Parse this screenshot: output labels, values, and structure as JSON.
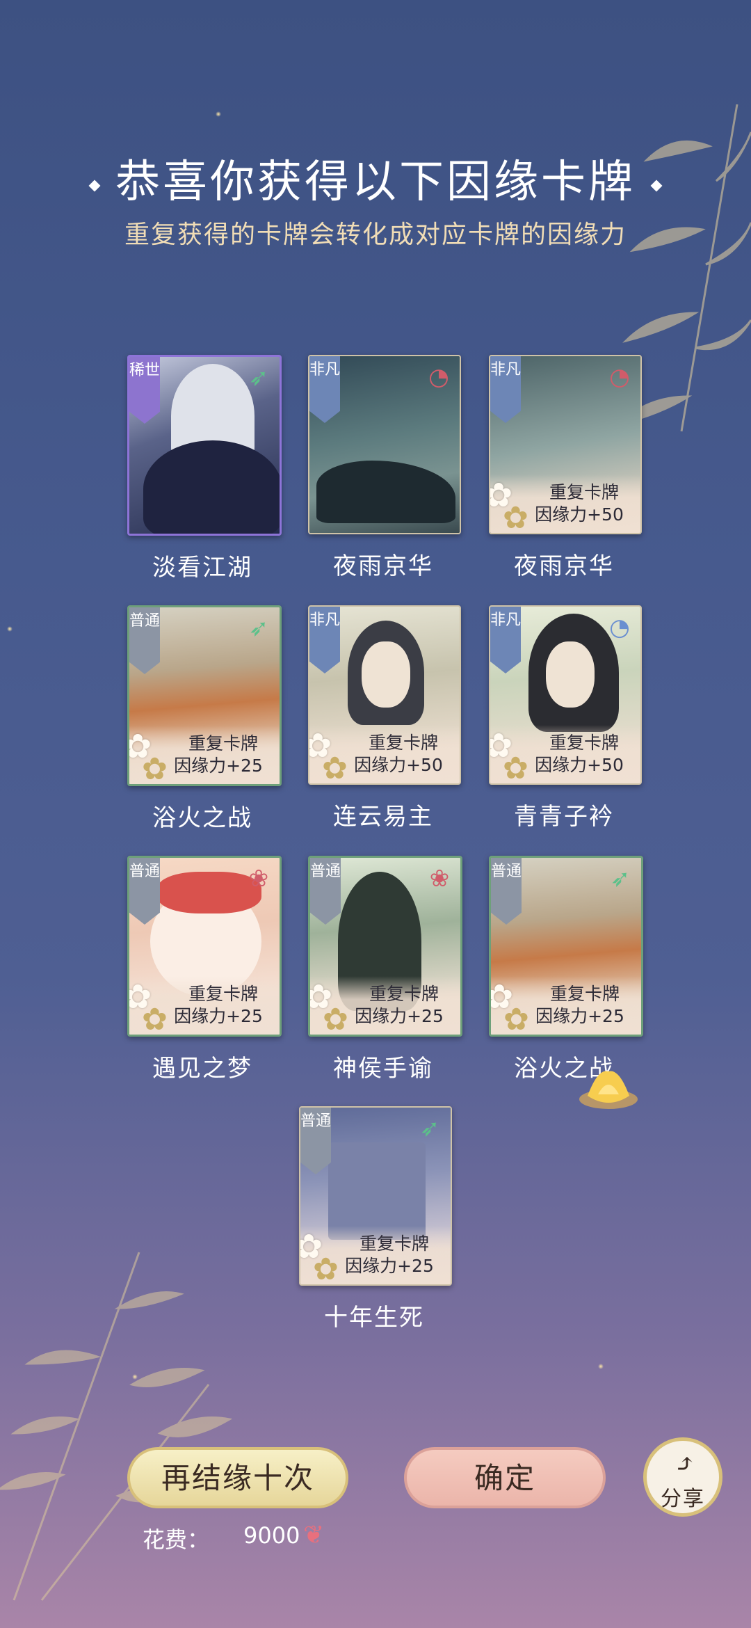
{
  "header": {
    "title": "恭喜你获得以下因缘卡牌",
    "subtitle": "重复获得的卡牌会转化成对应卡牌的因缘力"
  },
  "cards": [
    {
      "rarity": "稀世",
      "name": "淡看江湖",
      "duplicate": false,
      "dup_label": "",
      "bonus": ""
    },
    {
      "rarity": "非凡",
      "name": "夜雨京华",
      "duplicate": false,
      "dup_label": "",
      "bonus": ""
    },
    {
      "rarity": "非凡",
      "name": "夜雨京华",
      "duplicate": true,
      "dup_label": "重复卡牌",
      "bonus": "因缘力+50"
    },
    {
      "rarity": "普通",
      "name": "浴火之战",
      "duplicate": true,
      "dup_label": "重复卡牌",
      "bonus": "因缘力+25"
    },
    {
      "rarity": "非凡",
      "name": "连云易主",
      "duplicate": true,
      "dup_label": "重复卡牌",
      "bonus": "因缘力+50"
    },
    {
      "rarity": "非凡",
      "name": "青青子衿",
      "duplicate": true,
      "dup_label": "重复卡牌",
      "bonus": "因缘力+50"
    },
    {
      "rarity": "普通",
      "name": "遇见之梦",
      "duplicate": true,
      "dup_label": "重复卡牌",
      "bonus": "因缘力+25"
    },
    {
      "rarity": "普通",
      "name": "神侯手谕",
      "duplicate": true,
      "dup_label": "重复卡牌",
      "bonus": "因缘力+25"
    },
    {
      "rarity": "普通",
      "name": "浴火之战",
      "duplicate": true,
      "dup_label": "重复卡牌",
      "bonus": "因缘力+25"
    },
    {
      "rarity": "普通",
      "name": "十年生死",
      "duplicate": true,
      "dup_label": "重复卡牌",
      "bonus": "因缘力+25"
    }
  ],
  "footer": {
    "again_label": "再结缘十次",
    "confirm_label": "确定",
    "share_label": "分享",
    "cost_label": "花费：",
    "cost_value": "9000",
    "cost_icon": "butterfly-icon"
  },
  "colors": {
    "rare_tag": "#8d74cf",
    "uncommon_tag": "#6d86b6",
    "common_tag": "#8c95a4",
    "title_text": "#ffffff",
    "subtitle_text": "#f1ddb6"
  }
}
